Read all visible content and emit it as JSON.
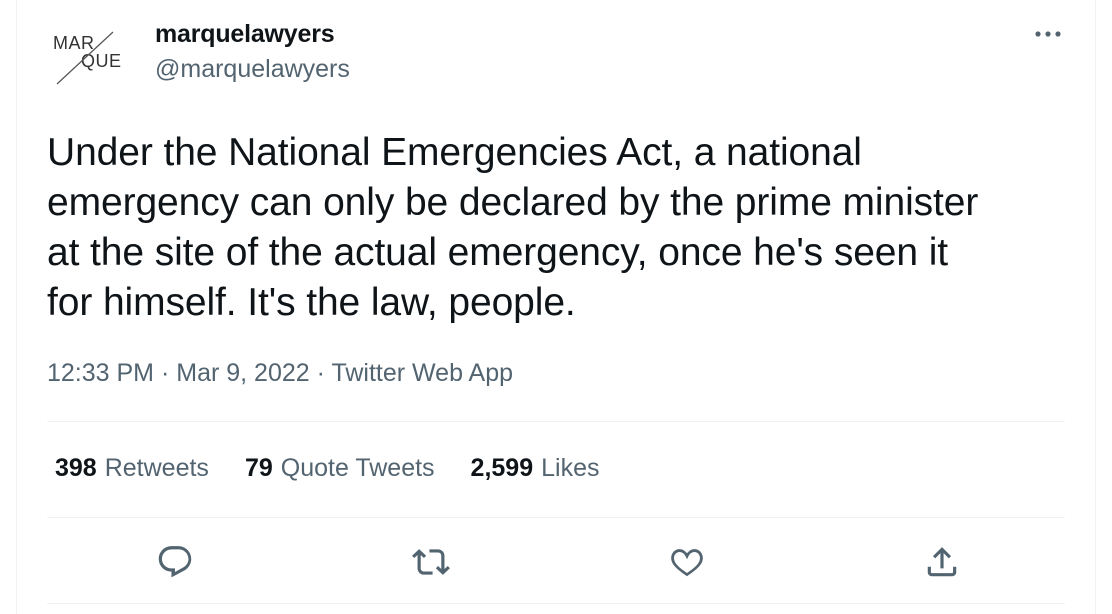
{
  "author": {
    "avatar_line1": "MAR",
    "avatar_line2": "QUE",
    "display_name": "marquelawyers",
    "handle": "@marquelawyers"
  },
  "tweet": {
    "text": "Under the National Emergencies Act, a national\nemergency can only be declared by the prime minister\nat the site of the actual emergency, once he's seen it\nfor himself. It's the law, people."
  },
  "meta": {
    "time": "12:33 PM",
    "separator": "·",
    "date": "Mar 9, 2022",
    "source": "Twitter Web App"
  },
  "stats": {
    "retweets_count": "398",
    "retweets_label": "Retweets",
    "quotes_count": "79",
    "quotes_label": "Quote Tweets",
    "likes_count": "2,599",
    "likes_label": "Likes"
  },
  "icons": {
    "more": "more-horizontal-icon",
    "reply": "reply-bubble-icon",
    "retweet": "retweet-arrows-icon",
    "like": "heart-icon",
    "share": "share-upload-icon"
  },
  "colors": {
    "text_primary": "#0f1419",
    "text_secondary": "#536471",
    "divider": "#eff3f4"
  }
}
